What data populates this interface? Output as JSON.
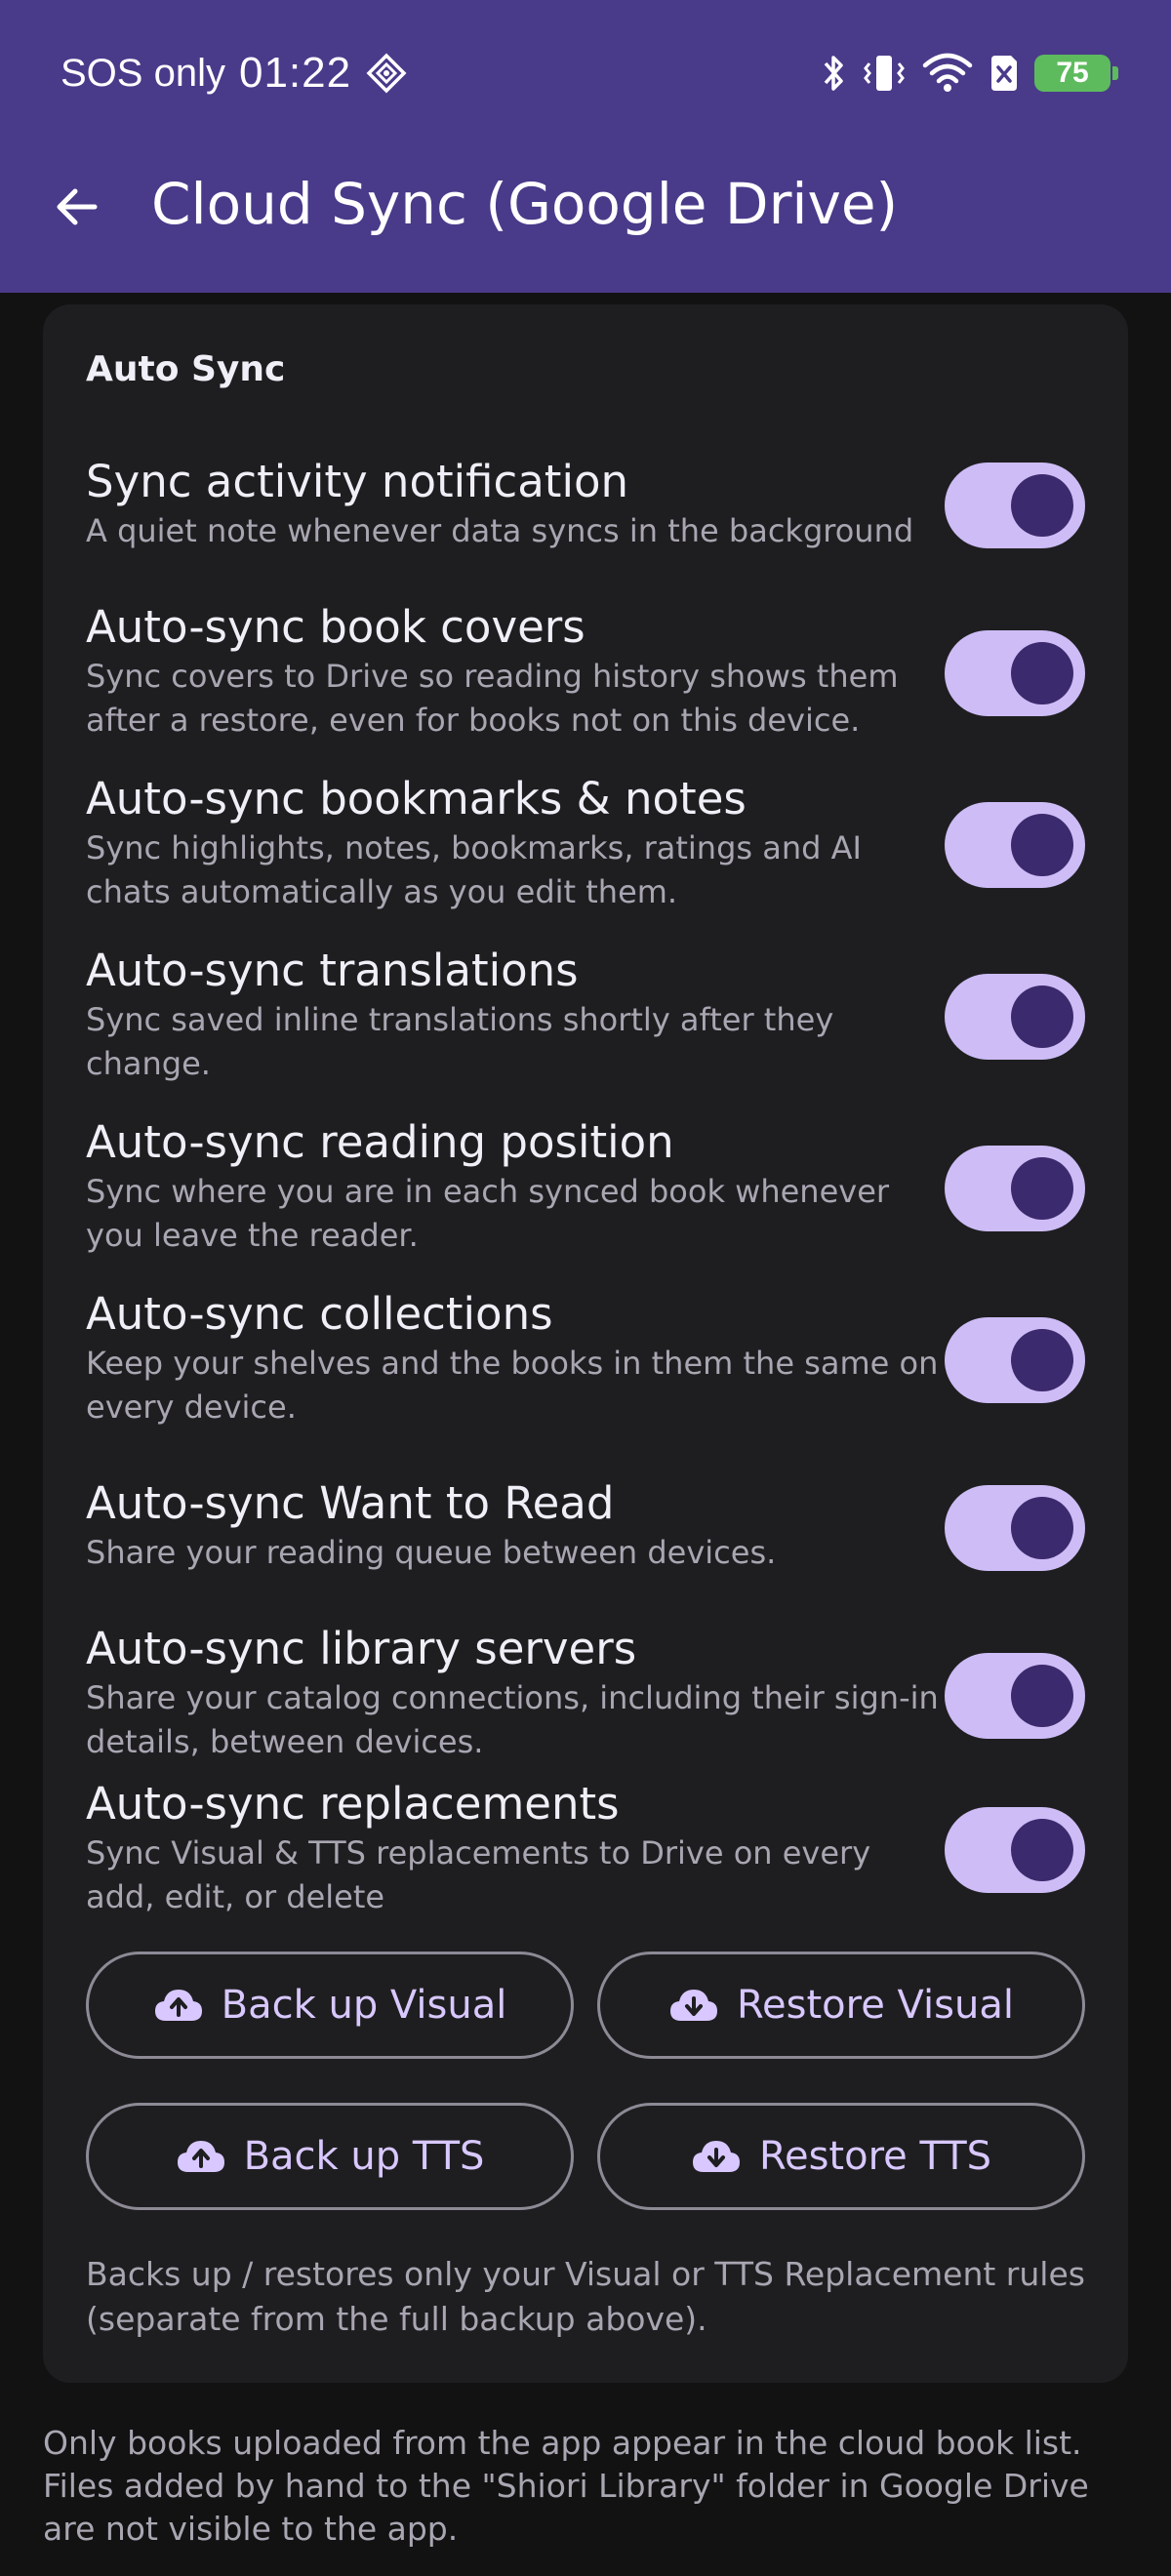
{
  "status_bar": {
    "carrier": "SOS only",
    "time": "01:22",
    "battery": "75"
  },
  "header": {
    "title": "Cloud Sync (Google Drive)"
  },
  "section": {
    "title": "Auto Sync"
  },
  "settings": [
    {
      "title": "Sync activity notification",
      "subtitle": "A quiet note whenever data syncs in the background",
      "enabled": true
    },
    {
      "title": "Auto-sync book covers",
      "subtitle": "Sync covers to Drive so reading history shows them after a restore, even for books not on this device.",
      "enabled": true
    },
    {
      "title": "Auto-sync bookmarks & notes",
      "subtitle": "Sync highlights, notes, bookmarks, ratings and AI chats automatically as you edit them.",
      "enabled": true
    },
    {
      "title": "Auto-sync translations",
      "subtitle": "Sync saved inline translations shortly after they change.",
      "enabled": true
    },
    {
      "title": "Auto-sync reading position",
      "subtitle": "Sync where you are in each synced book whenever you leave the reader.",
      "enabled": true
    },
    {
      "title": "Auto-sync collections",
      "subtitle": "Keep your shelves and the books in them the same on every device.",
      "enabled": true
    },
    {
      "title": "Auto-sync Want to Read",
      "subtitle": "Share your reading queue between devices.",
      "enabled": true
    },
    {
      "title": "Auto-sync library servers",
      "subtitle": "Share your catalog connections, including their sign-in details, between devices.",
      "enabled": true
    },
    {
      "title": "Auto-sync replacements",
      "subtitle": "Sync Visual & TTS replacements to Drive on every add, edit, or delete",
      "enabled": true
    }
  ],
  "buttons": {
    "backup_visual": "Back up Visual",
    "restore_visual": "Restore Visual",
    "backup_tts": "Back up TTS",
    "restore_tts": "Restore TTS"
  },
  "replacement_note": "Backs up / restores only your Visual or TTS Replacement rules (separate from the full backup above).",
  "footer_note": "Only books uploaded from the app appear in the cloud book list. Files added by hand to the \"Shiori Library\" folder in Google Drive are not visible to the app.",
  "colors": {
    "app_bar": "#4a3a8a",
    "toggle_track": "#cdbcf6",
    "toggle_thumb": "#3c2a6e",
    "battery": "#5dbb5d"
  }
}
